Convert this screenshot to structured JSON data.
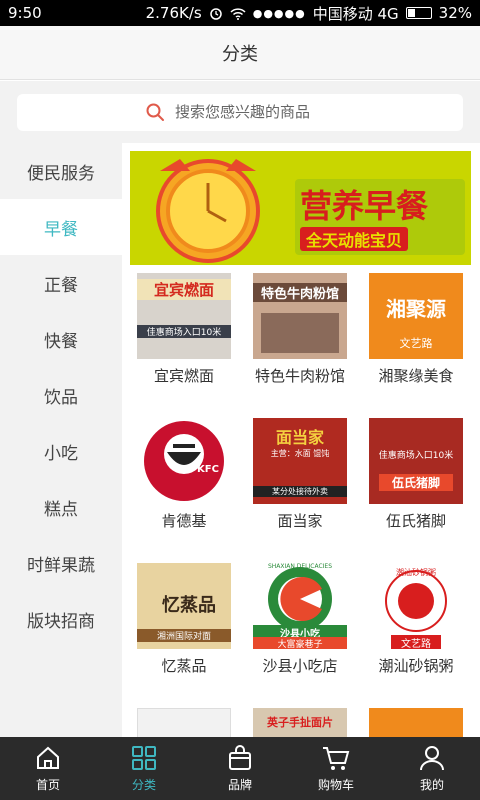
{
  "status": {
    "time": "9:50",
    "speed": "2.76K/s",
    "carrier": "中国移动 4G",
    "battery": "32%"
  },
  "header": {
    "title": "分类"
  },
  "search": {
    "placeholder": "搜索您感兴趣的商品"
  },
  "sidebar": {
    "items": [
      {
        "label": "便民服务"
      },
      {
        "label": "早餐"
      },
      {
        "label": "正餐"
      },
      {
        "label": "快餐"
      },
      {
        "label": "饮品"
      },
      {
        "label": "小吃"
      },
      {
        "label": "糕点"
      },
      {
        "label": "时鲜果蔬"
      },
      {
        "label": "版块招商"
      }
    ],
    "active_index": 1
  },
  "banner": {
    "text_main": "营养早餐",
    "text_sub": "全天动能宝贝"
  },
  "shops": [
    {
      "name": "宜宾燃面",
      "sign": "宜宾燃面",
      "sub": "佳惠商场入口10米"
    },
    {
      "name": "特色牛肉粉馆",
      "sign": "特色牛肉粉馆"
    },
    {
      "name": "湘聚缘美食",
      "sign": "湘聚源",
      "sub": "文艺路"
    },
    {
      "name": "肯德基",
      "sign": "KFC"
    },
    {
      "name": "面当家",
      "sign": "面当家",
      "sub": "主营：水面 馄饨",
      "sub2": "某分处接待外卖"
    },
    {
      "name": "伍氏猪脚",
      "sign": "伍氏猪脚",
      "sub": "佳惠商场入口10米"
    },
    {
      "name": "忆蒸品",
      "sign": "忆蒸品",
      "sub": "湘洲国际对面"
    },
    {
      "name": "沙县小吃店",
      "sign": "沙县小吃",
      "sub": "大富豪巷子",
      "ring": "SHAXIAN DELICACIES"
    },
    {
      "name": "潮汕砂锅粥",
      "sign": "潮汕砂锅粥",
      "sub": "文艺路"
    },
    {
      "sign": "英子手扯面片"
    }
  ],
  "nav": {
    "items": [
      {
        "label": "首页"
      },
      {
        "label": "分类"
      },
      {
        "label": "品牌"
      },
      {
        "label": "购物车"
      },
      {
        "label": "我的"
      }
    ],
    "active_index": 1
  }
}
